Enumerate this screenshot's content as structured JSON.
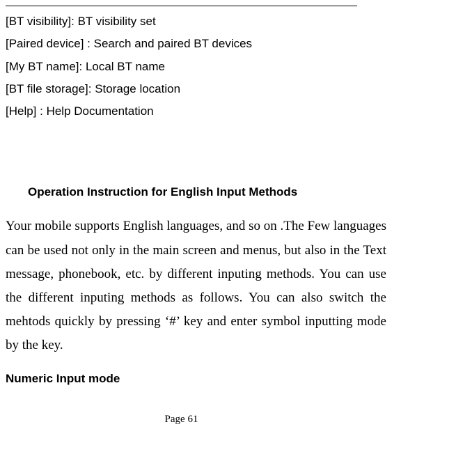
{
  "bt_items": [
    "[BT visibility]: BT visibility set",
    "[Paired device] : Search and paired BT devices",
    "[My BT name]: Local BT name",
    "[BT file storage]: Storage location",
    "[Help] : Help Documentation"
  ],
  "section_heading": "Operation Instruction for English Input Methods",
  "body_paragraph": "Your mobile supports English languages, and so on .The Few languages can be used not only in the main screen and menus, but also in the Text message, phonebook, etc. by different inputing methods. You can use the different inputing methods as follows. You can also switch the mehtods quickly by pressing ‘#’ key and enter symbol inputting mode by the key.",
  "sub_heading": "Numeric Input mode",
  "page_number": "Page 61"
}
